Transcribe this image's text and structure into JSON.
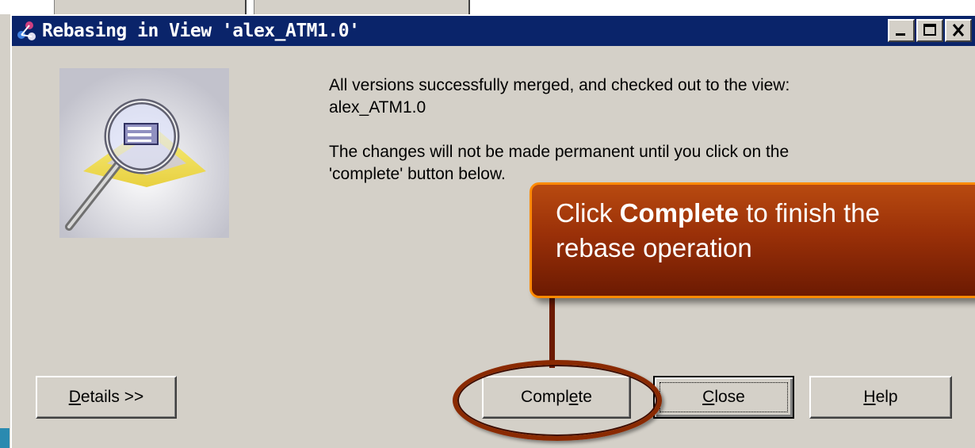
{
  "dialog": {
    "title": "Rebasing in View 'alex_ATM1.0'",
    "title_buttons": [
      "minimize",
      "maximize",
      "close"
    ]
  },
  "message": {
    "line1": "All versions successfully merged, and checked out to the view:",
    "line2": "alex_ATM1.0",
    "line3": "The changes will not be made permanent until you click on the",
    "line4": "'complete' button below."
  },
  "buttons": {
    "details": "Details >>",
    "complete": "Complete",
    "close": "Close",
    "help": "Help"
  },
  "callout": {
    "prefix": "Click ",
    "bold": "Complete",
    "suffix": " to finish the",
    "line2": "rebase operation"
  },
  "icons": {
    "app": "clearcase-view-icon",
    "illustration": "magnifier-view-illustration"
  },
  "colors": {
    "titlebar": "#0a246a",
    "callout": "#9a3008",
    "callout_border": "#ff8a00"
  }
}
